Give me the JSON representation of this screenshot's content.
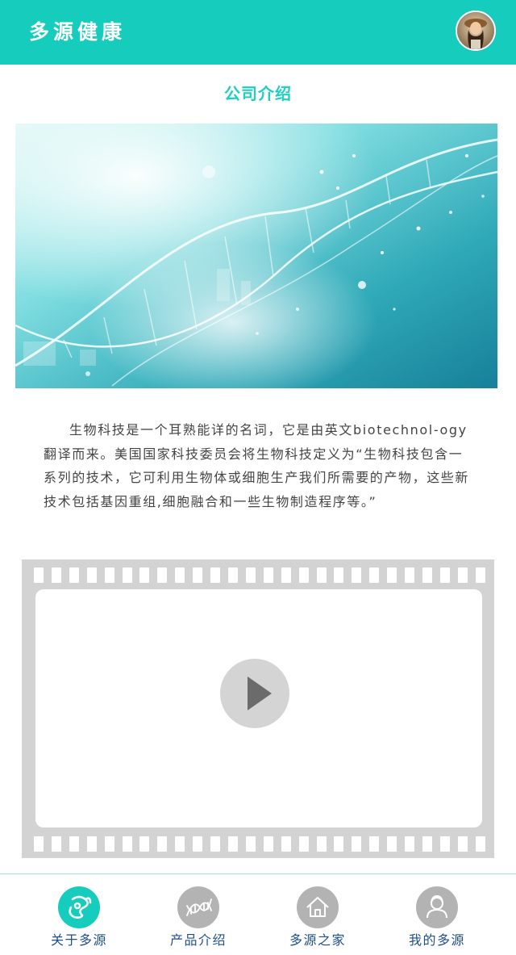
{
  "header": {
    "app_title": "多源健康",
    "avatar_icon": "user-avatar-photo"
  },
  "section": {
    "title": "公司介绍"
  },
  "banner": {
    "image": "dna-helix-illustration"
  },
  "intro": {
    "text": "生物科技是一个耳熟能详的名词，它是由英文biotechnol-ogy翻译而来。美国国家科技委员会将生物科技定义为“生物科技包含一系列的技术，它可利用生物体或细胞生产我们所需要的产物，这些新技术包括基因重组,细胞融合和一些生物制造程序等。”"
  },
  "video": {
    "play_icon": "play-icon"
  },
  "nav": {
    "items": [
      {
        "label": "关于多源",
        "icon": "about-icon",
        "active": true
      },
      {
        "label": "产品介绍",
        "icon": "dna-icon",
        "active": false
      },
      {
        "label": "多源之家",
        "icon": "home-icon",
        "active": false
      },
      {
        "label": "我的多源",
        "icon": "user-icon",
        "active": false
      }
    ]
  },
  "colors": {
    "accent": "#16ccbc",
    "nav_label": "#1e4e8c",
    "inactive_icon": "#b3b3b3"
  }
}
